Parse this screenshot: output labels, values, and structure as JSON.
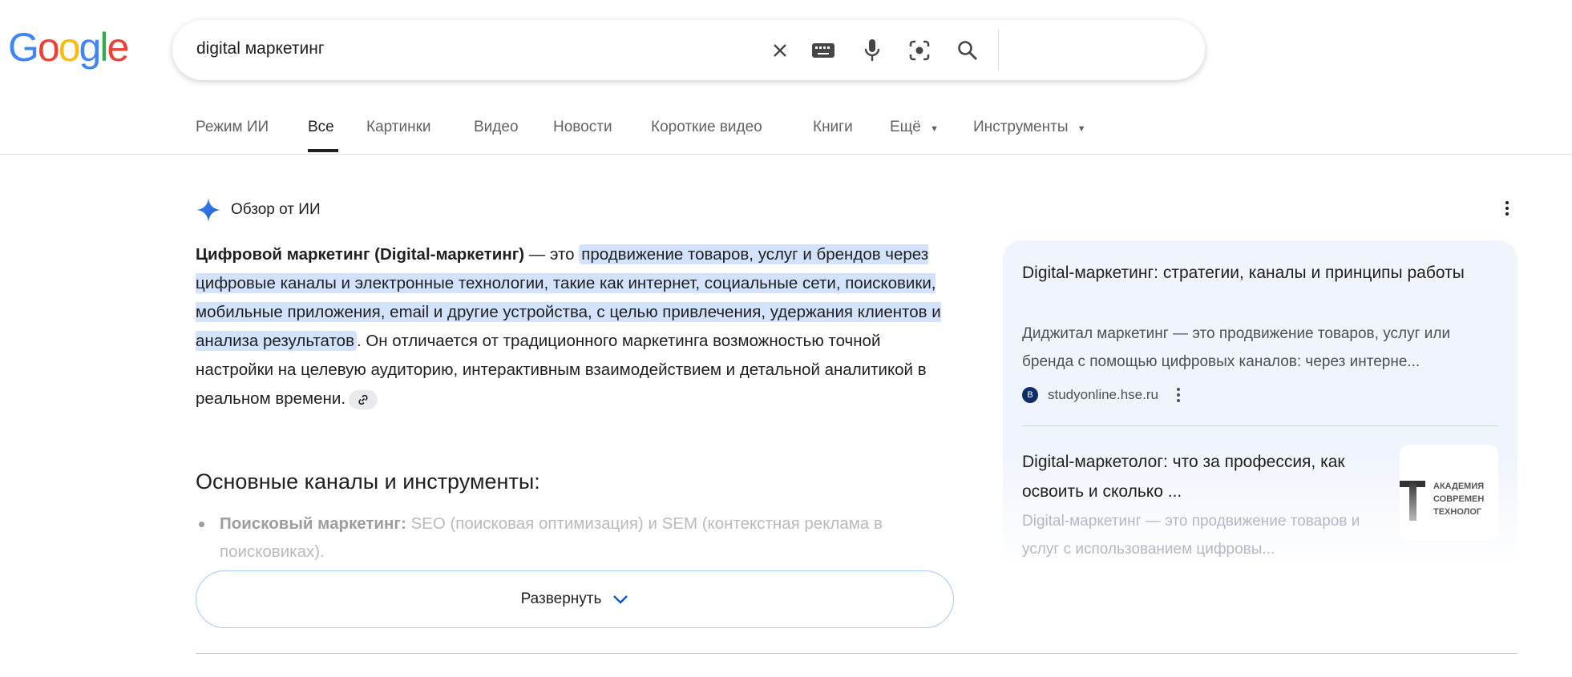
{
  "logo": {
    "text": "Google",
    "colors": [
      "#4285f4",
      "#ea4335",
      "#fbbc05",
      "#4285f4",
      "#34a853",
      "#ea4335"
    ]
  },
  "search": {
    "query": "digital маркетинг",
    "icons": [
      "close-icon",
      "keyboard-icon",
      "microphone-icon",
      "lens-icon",
      "search-icon"
    ]
  },
  "tabs": [
    {
      "label": "Режим ИИ"
    },
    {
      "label": "Все",
      "active": true
    },
    {
      "label": "Картинки"
    },
    {
      "label": "Видео"
    },
    {
      "label": "Новости"
    },
    {
      "label": "Короткие видео"
    },
    {
      "label": "Книги"
    },
    {
      "label": "Ещё"
    },
    {
      "label": "Инструменты"
    }
  ],
  "ai_overview": {
    "title": "Обзор от ИИ",
    "bold": "Цифровой маркетинг (Digital-маркетинг)",
    "dash": " — это ",
    "highlight": "продвижение товаров, услуг и брендов через цифровые каналы и электронные технологии, такие как интернет, социальные сети, поисковики, мобильные приложения, email и другие устройства, с целью привлечения, удержания клиентов и анализа результатов",
    "rest": ". Он отличается от традиционного маркетинга возможностью точной настройки на целевую аудиторию, интерактивным взаимодействием и детальной аналитикой в реальном времени.",
    "heading": "Основные каналы и инструменты:",
    "bullet_bold": "Поисковый маркетинг:",
    "bullet_text": " SEO (поисковая оптимизация) и SEM (контекстная реклама в поисковиках).",
    "expand_label": "Развернуть",
    "accent": "#0b57d0"
  },
  "sources": [
    {
      "title": "Digital-маркетинг: стратегии, каналы и принципы работы",
      "snippet": "Диджитал маркетинг — это продвижение товаров, услуг или бренда с помощью цифровых каналов: через интерне...",
      "site": "studyonline.hse.ru"
    },
    {
      "title": "Digital-маркетолог: что за профессия, как освоить и сколько ...",
      "snippet": "Digital-маркетинг — это продвижение товаров и услуг с использованием цифровы...",
      "thumb_text": [
        "АКАДЕМИЯ",
        "СОВРЕМЕН",
        "ТЕХНОЛОГ"
      ]
    }
  ]
}
